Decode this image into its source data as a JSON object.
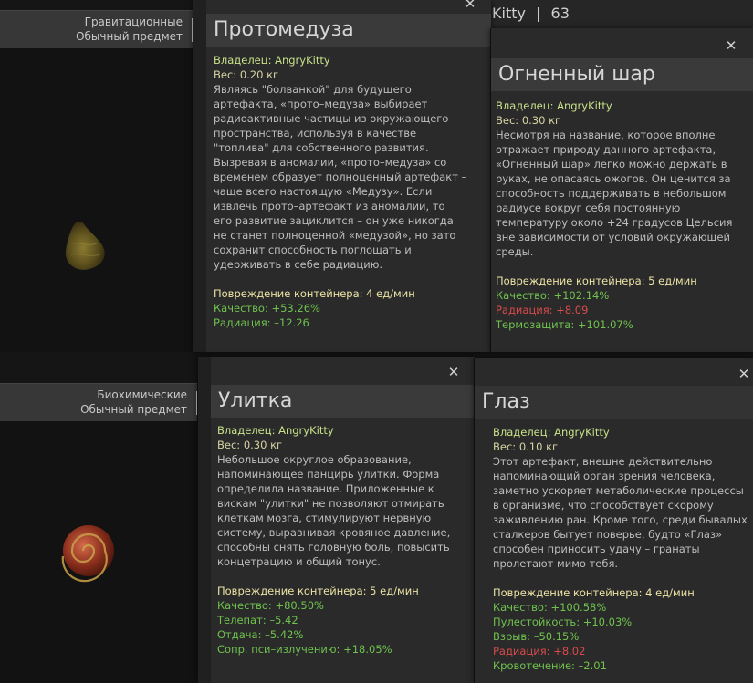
{
  "topbar": {
    "name": "Kitty",
    "separator": "|",
    "count": "63"
  },
  "strips": [
    {
      "category": "Гравитационные",
      "rarity": "Обычный предмет"
    },
    {
      "category": "Биохимические",
      "rarity": "Обычный предмет"
    }
  ],
  "cards": [
    {
      "title": "Протомедуза",
      "owner": "Владелец: AngryKitty",
      "weight": "Вес: 0.20 кг",
      "desc": [
        "Являясь \"болванкой\" для будущего",
        "артефакта, «прото–медуза» выбирает",
        "радиоактивные частицы из окружающего",
        "пространства, используя в качестве",
        "\"топлива\" для собственного развития.",
        "Вызревая в аномалии, «прото–медуза» со",
        "временем образует полноценный артефакт –",
        "чаще всего настоящую «Медузу». Если",
        "извлечь прото–артефакт из аномалии, то",
        "его развитие зациклится – он уже никогда",
        "не станет полноценной «медузой», но зато",
        "сохранит способность поглощать и",
        "удерживать в себе радиацию."
      ],
      "damage": "Повреждение контейнера: 4 ед/мин",
      "stats": [
        {
          "text": "Качество: +53.26%",
          "tone": "green"
        },
        {
          "text": "Радиация: –12.26",
          "tone": "green"
        }
      ]
    },
    {
      "title": "Огненный шар",
      "owner": "Владелец: AngryKitty",
      "weight": "Вес: 0.30 кг",
      "desc": [
        "Несмотря на название, которое вполне",
        "отражает природу данного артефакта,",
        "«Огненный шар» легко можно держать в",
        "руках, не опасаясь ожогов. Он ценится за",
        "способность поддерживать в небольшом",
        "радиусе вокруг себя постоянную",
        "температуру около +24 градусов Цельсия",
        "вне зависимости от условий окружающей",
        "среды."
      ],
      "damage": "Повреждение контейнера: 5 ед/мин",
      "stats": [
        {
          "text": "Качество: +102.14%",
          "tone": "green"
        },
        {
          "text": "Радиация: +8.09",
          "tone": "red"
        },
        {
          "text": "Термозащита: +101.07%",
          "tone": "green"
        }
      ]
    },
    {
      "title": "Улитка",
      "owner": "Владелец: AngryKitty",
      "weight": "Вес: 0.30 кг",
      "desc": [
        "Небольшое округлое образование,",
        "напоминающее панцирь улитки. Форма",
        "определила название. Приложенные к",
        "вискам \"улитки\" не позволяют отмирать",
        "клеткам мозга, стимулируют нервную",
        "систему, выравнивая кровяное давление,",
        "способны снять головную боль, повысить",
        "концетрацию и общий тонус."
      ],
      "damage": "Повреждение контейнера: 5 ед/мин",
      "stats": [
        {
          "text": "Качество: +80.50%",
          "tone": "green"
        },
        {
          "text": "Телепат: –5.42",
          "tone": "green"
        },
        {
          "text": "Отдача: –5.42%",
          "tone": "green"
        },
        {
          "text": "Сопр. пси–излучению: +18.05%",
          "tone": "green"
        }
      ]
    },
    {
      "title": "Глаз",
      "owner": "Владелец: AngryKitty",
      "weight": "Вес: 0.10 кг",
      "desc": [
        "Этот артефакт, внешне действительно",
        "напоминающий орган зрения человека,",
        "заметно ускоряет метаболические процессы",
        "в организме, что способствует скорому",
        "заживлению ран. Кроме того, среди бывалых",
        "сталкеров бытует поверье, будто «Глаз»",
        "способен приносить удачу – гранаты",
        "пролетают мимо тебя."
      ],
      "damage": "Повреждение контейнера: 4 ед/мин",
      "stats": [
        {
          "text": "Качество: +100.58%",
          "tone": "green"
        },
        {
          "text": "Пулестойкость: +10.03%",
          "tone": "green"
        },
        {
          "text": "Взрыв: –50.15%",
          "tone": "green"
        },
        {
          "text": "Радиация: +8.02",
          "tone": "red"
        },
        {
          "text": "Кровотечение: –2.01",
          "tone": "green"
        }
      ]
    }
  ],
  "close_glyph": "✕"
}
